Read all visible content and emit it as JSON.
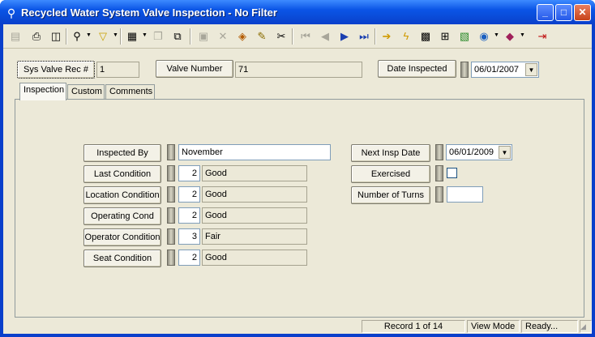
{
  "window": {
    "title": "Recycled Water System Valve Inspection - No Filter",
    "app_icon": "valve-icon"
  },
  "titlebar_buttons": {
    "minimize": "_",
    "maximize": "□",
    "close": "✕"
  },
  "toolbar_icons": [
    "new-record-icon",
    "print-icon",
    "print-preview-icon",
    "find-icon",
    "filter-icon",
    "form-view-icon",
    "copy-record-icon",
    "paste-icon",
    "save-icon",
    "delete-icon",
    "attach-icon",
    "edit-icon",
    "cut-icon",
    "first-record-icon",
    "previous-record-icon",
    "next-record-icon",
    "last-record-icon",
    "goto-icon",
    "lightning-icon",
    "report-icon",
    "tree-icon",
    "map-icon",
    "globe-icon",
    "book-icon",
    "exit-icon"
  ],
  "header": {
    "sys_valve_rec_label": "Sys Valve Rec #",
    "sys_valve_rec_value": "1",
    "valve_number_label": "Valve Number",
    "valve_number_value": "71",
    "date_inspected_label": "Date Inspected",
    "date_inspected_value": "06/01/2007"
  },
  "tabs": [
    {
      "label": "Inspection"
    },
    {
      "label": "Custom"
    },
    {
      "label": "Comments"
    }
  ],
  "inspection": {
    "inspected_by_label": "Inspected By",
    "inspected_by_value": "November",
    "rows": [
      {
        "label": "Last Condition",
        "code": "2",
        "desc": "Good"
      },
      {
        "label": "Location Condition",
        "code": "2",
        "desc": "Good"
      },
      {
        "label": "Operating Cond",
        "code": "2",
        "desc": "Good"
      },
      {
        "label": "Operator Condition",
        "code": "3",
        "desc": "Fair"
      },
      {
        "label": "Seat Condition",
        "code": "2",
        "desc": "Good"
      }
    ],
    "next_insp_date_label": "Next Insp Date",
    "next_insp_date_value": "06/01/2009",
    "exercised_label": "Exercised",
    "exercised_checked": false,
    "number_of_turns_label": "Number of Turns",
    "number_of_turns_value": ""
  },
  "status": {
    "record": "Record 1 of 14",
    "mode": "View Mode",
    "state": "Ready..."
  }
}
